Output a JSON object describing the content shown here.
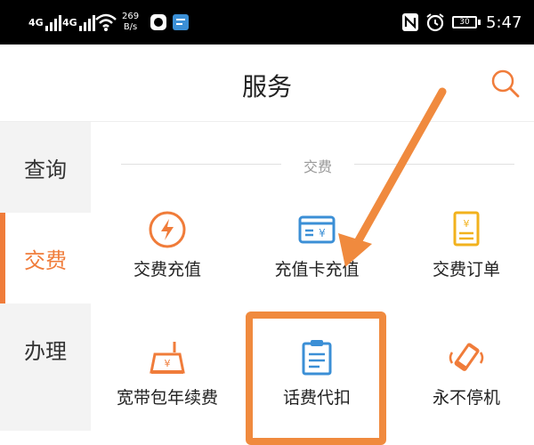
{
  "status_bar": {
    "sim1": "4G",
    "sim2": "4G",
    "speed_value": "269",
    "speed_unit": "B/s",
    "battery": "30",
    "time": "5:47"
  },
  "header": {
    "title": "服务"
  },
  "sidebar": {
    "items": [
      {
        "label": "查询",
        "active": false
      },
      {
        "label": "交费",
        "active": true
      },
      {
        "label": "办理",
        "active": false
      }
    ]
  },
  "section": {
    "title": "交费",
    "tiles": [
      {
        "label": "交费充值",
        "icon": "lightning-circle-icon"
      },
      {
        "label": "充值卡充值",
        "icon": "recharge-card-icon"
      },
      {
        "label": "交费订单",
        "icon": "order-list-icon"
      },
      {
        "label": "宽带包年续费",
        "icon": "router-icon"
      },
      {
        "label": "话费代扣",
        "icon": "clipboard-bill-icon"
      },
      {
        "label": "永不停机",
        "icon": "phone-vibrate-icon"
      }
    ]
  },
  "colors": {
    "accent": "#f07c3a",
    "blue": "#3b8fd6",
    "yellow": "#f2b21d",
    "annotation": "#f08a3e"
  }
}
